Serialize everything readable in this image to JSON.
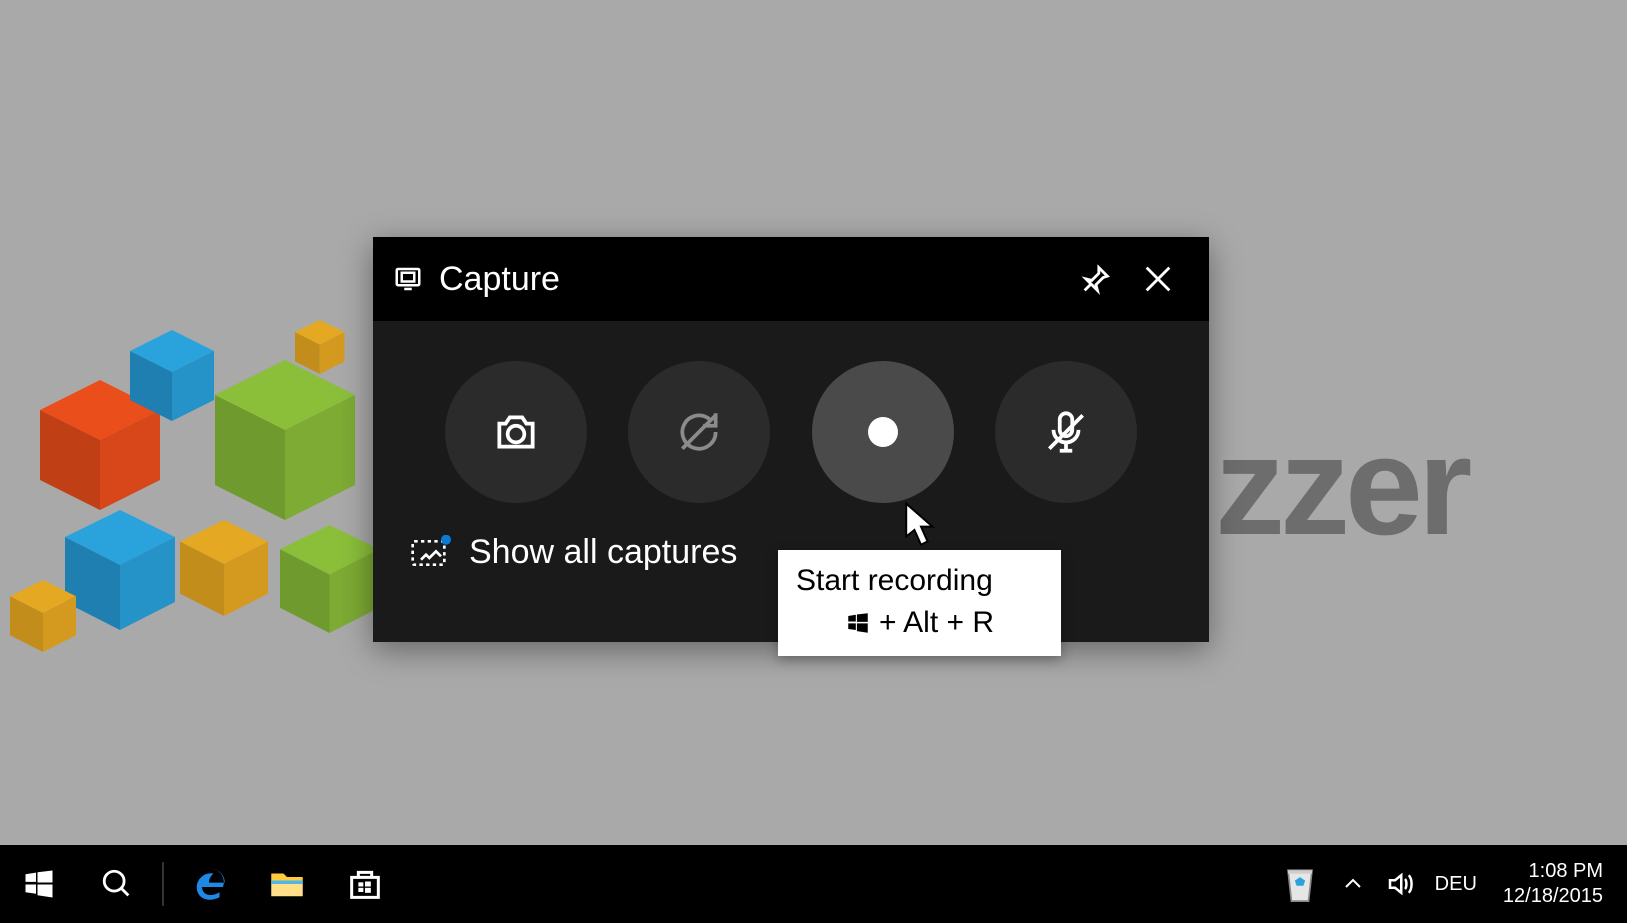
{
  "capture": {
    "title": "Capture",
    "show_all": "Show all captures"
  },
  "tooltip": {
    "title": "Start recording",
    "shortcut": "+ Alt + R"
  },
  "taskbar": {
    "language": "DEU",
    "time": "1:08 PM",
    "date": "12/18/2015"
  },
  "wallpaper": {
    "partial_text": "zzer"
  }
}
